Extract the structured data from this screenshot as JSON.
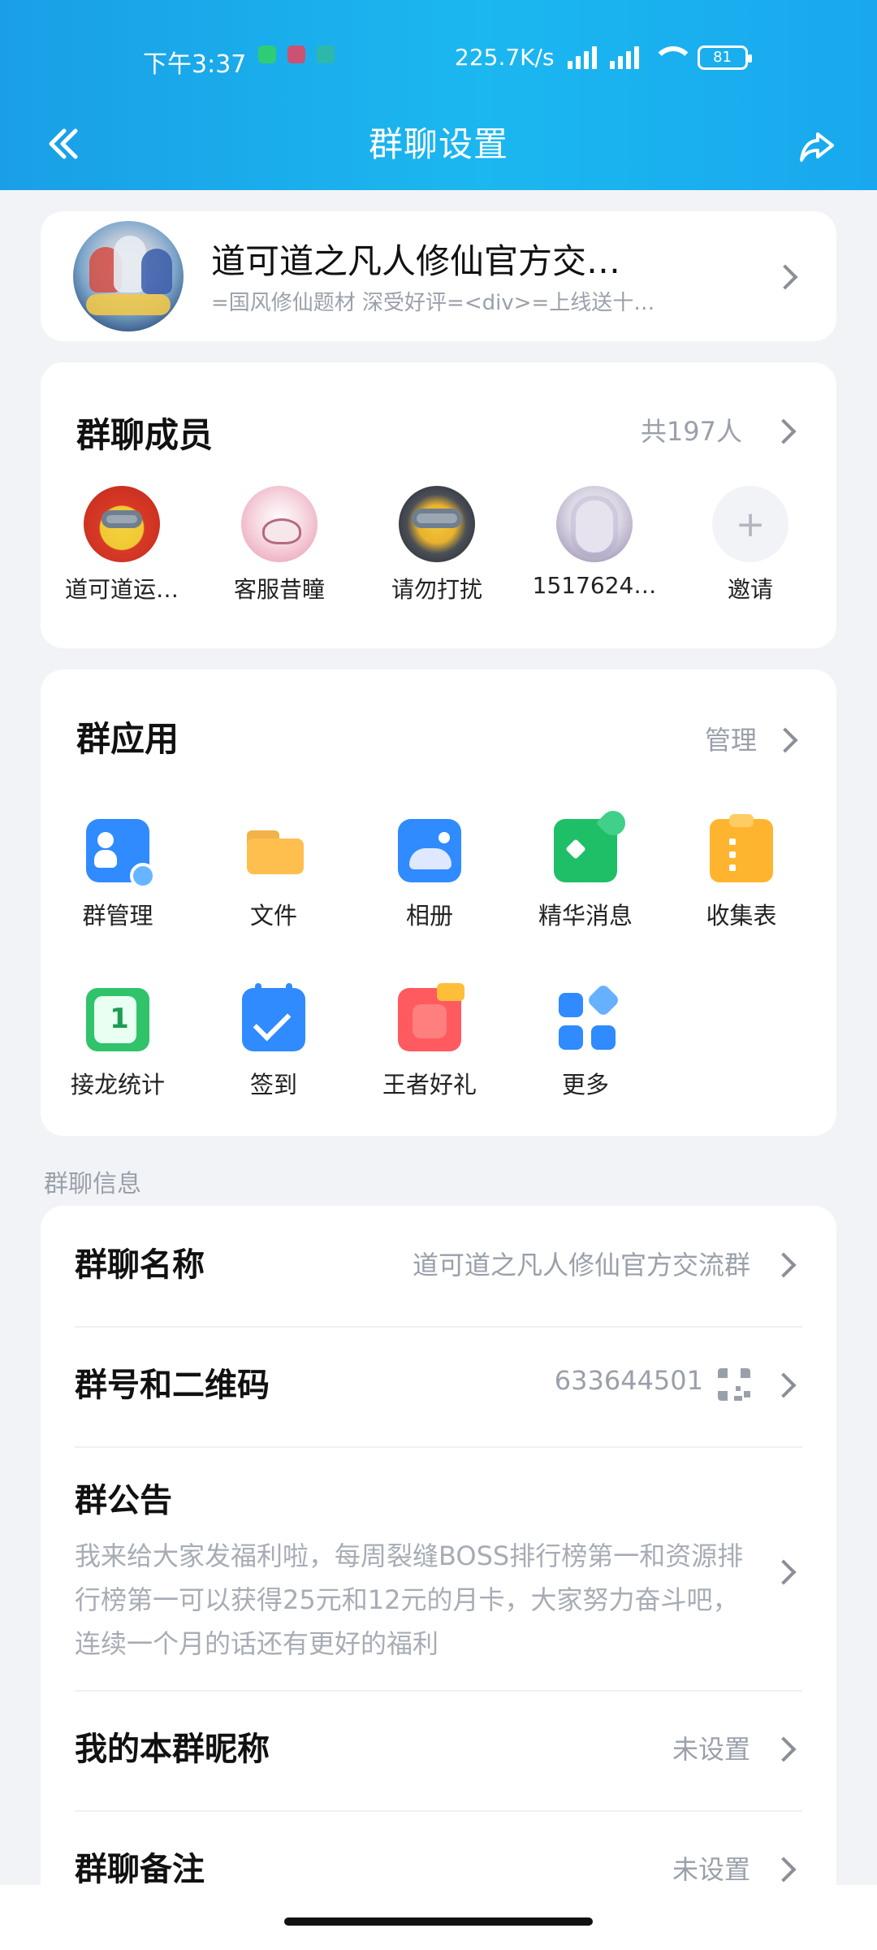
{
  "status_bar": {
    "time": "下午3:37",
    "network_speed": "225.7K/s",
    "battery": "81"
  },
  "nav": {
    "title": "群聊设置"
  },
  "group": {
    "name": "道可道之凡人修仙官方交…",
    "description": "=国风修仙题材 深受好评=<div>=上线送十…"
  },
  "members": {
    "title": "群聊成员",
    "count": "共197人",
    "items": [
      {
        "name": "道可道运…",
        "avatar": "minion-avatar"
      },
      {
        "name": "客服昔瞳",
        "avatar": "anime-avatar"
      },
      {
        "name": "请勿打扰",
        "avatar": "minions-avatar"
      },
      {
        "name": "1517624…",
        "avatar": "girl-avatar"
      },
      {
        "name": "邀请",
        "avatar": "plus-icon"
      }
    ],
    "invite_symbol": "+"
  },
  "apps": {
    "title": "群应用",
    "manage": "管理",
    "items": [
      {
        "label": "群管理",
        "icon": "group-manage-icon"
      },
      {
        "label": "文件",
        "icon": "folder-icon"
      },
      {
        "label": "相册",
        "icon": "album-icon"
      },
      {
        "label": "精华消息",
        "icon": "essence-message-icon"
      },
      {
        "label": "收集表",
        "icon": "form-icon"
      },
      {
        "label": "接龙统计",
        "icon": "relay-stats-icon"
      },
      {
        "label": "签到",
        "icon": "checkin-icon"
      },
      {
        "label": "王者好礼",
        "icon": "king-gift-icon"
      },
      {
        "label": "更多",
        "icon": "more-apps-icon"
      }
    ]
  },
  "info": {
    "section_label": "群聊信息",
    "rows": {
      "name": {
        "label": "群聊名称",
        "value": "道可道之凡人修仙官方交流群"
      },
      "number": {
        "label": "群号和二维码",
        "value": "633644501"
      },
      "notice": {
        "label": "群公告",
        "text": "我来给大家发福利啦，每周裂缝BOSS排行榜第一和资源排行榜第一可以获得25元和12元的月卡，大家努力奋斗吧，连续一个月的话还有更好的福利"
      },
      "nickname": {
        "label": "我的本群昵称",
        "value": "未设置"
      },
      "remark": {
        "label": "群聊备注",
        "value": "未设置"
      }
    }
  }
}
